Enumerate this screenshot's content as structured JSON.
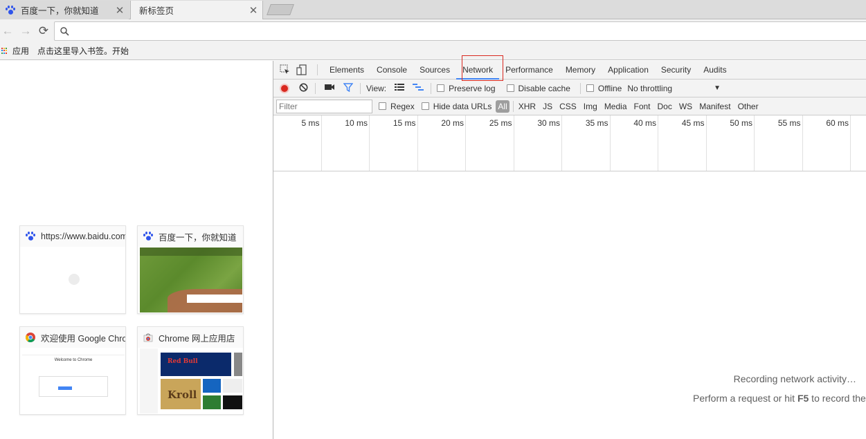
{
  "browser": {
    "tabs": [
      {
        "title": "百度一下，你就知道",
        "close": "✕",
        "active": false
      },
      {
        "title": "新标签页",
        "close": "✕",
        "active": true
      }
    ],
    "nav": {
      "back": "←",
      "forward": "→",
      "reload": "⟳",
      "search_icon": "search-icon"
    },
    "bookmarks": {
      "apps": "应用",
      "import": "点击这里导入书签。",
      "start": "开始"
    }
  },
  "new_tab_page": {
    "tiles": [
      {
        "title": "https://www.baidu.com",
        "favicon": "baidu-paw-icon"
      },
      {
        "title": "百度一下，你就知道",
        "favicon": "baidu-paw-icon"
      },
      {
        "title": "欢迎使用 Google Chrome",
        "favicon": "chrome-logo-icon",
        "thumb_heading": "Welcome to Chrome"
      },
      {
        "title": "Chrome 网上应用店",
        "favicon": "chrome-webstore-icon",
        "thumb_brand": "Red Bull",
        "thumb_word": "Kroll"
      }
    ]
  },
  "devtools": {
    "tabs": [
      "Elements",
      "Console",
      "Sources",
      "Network",
      "Performance",
      "Memory",
      "Application",
      "Security",
      "Audits"
    ],
    "active_tab": "Network",
    "network_toolbar": {
      "view_label": "View:",
      "preserve_log": "Preserve log",
      "disable_cache": "Disable cache",
      "offline": "Offline",
      "throttling": "No throttling",
      "dropdown_arrow": "▼"
    },
    "filter_bar": {
      "filter_placeholder": "Filter",
      "regex": "Regex",
      "hide_data_urls": "Hide data URLs",
      "types": [
        "All",
        "XHR",
        "JS",
        "CSS",
        "Img",
        "Media",
        "Font",
        "Doc",
        "WS",
        "Manifest",
        "Other"
      ]
    },
    "timeline_ticks": [
      "5 ms",
      "10 ms",
      "15 ms",
      "20 ms",
      "25 ms",
      "30 ms",
      "35 ms",
      "40 ms",
      "45 ms",
      "50 ms",
      "55 ms",
      "60 ms"
    ],
    "empty_state": {
      "line1": "Recording network activity…",
      "line2_prefix": "Perform a request or hit ",
      "line2_key": "F5",
      "line2_suffix": " to record the"
    },
    "colors": {
      "record": "#d9281f",
      "accent": "#4285f4",
      "filter_icon": "#4285f4"
    }
  }
}
